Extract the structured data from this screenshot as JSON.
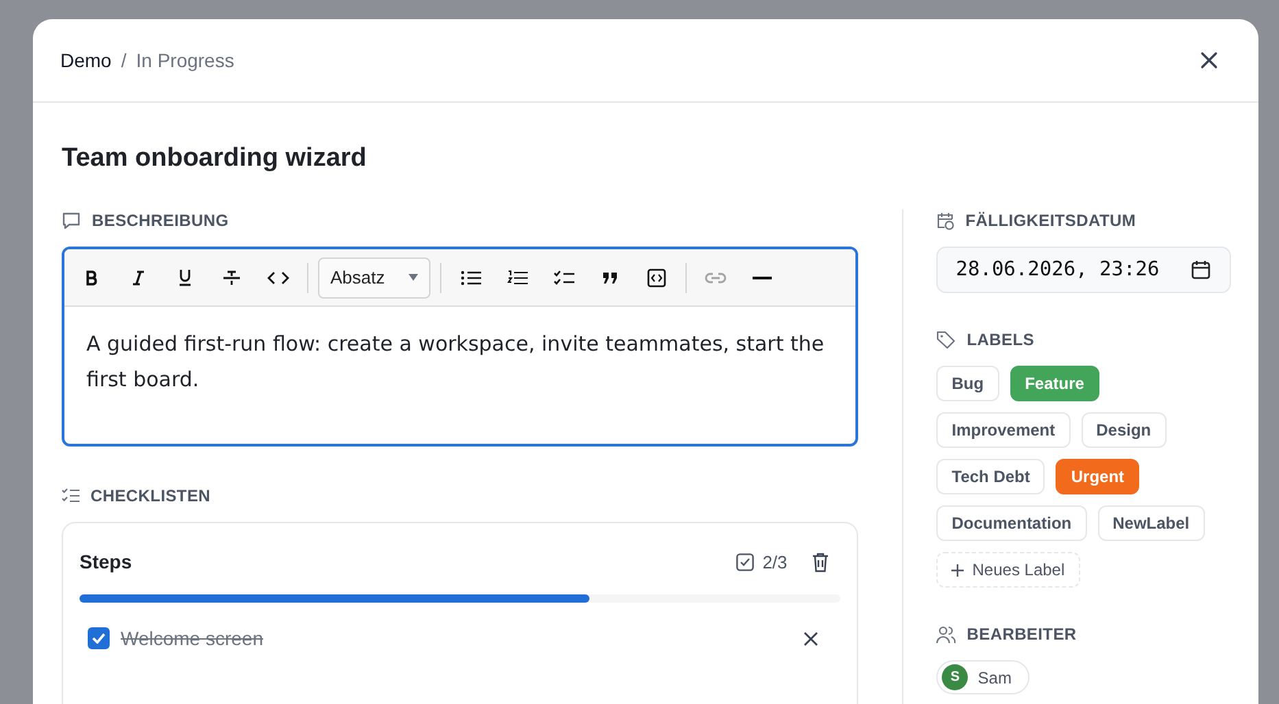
{
  "breadcrumb": {
    "project": "Demo",
    "separator": "/",
    "status": "In Progress"
  },
  "title": "Team onboarding wizard",
  "description": {
    "heading": "BESCHREIBUNG",
    "block_style": "Absatz",
    "text": "A guided first-run flow: create a workspace, invite teammates, start the first board."
  },
  "checklists": {
    "heading": "CHECKLISTEN",
    "lists": [
      {
        "title": "Steps",
        "count": "2/3",
        "level": 0.67,
        "items": [
          {
            "text": "Welcome screen",
            "checked": true
          }
        ]
      }
    ]
  },
  "due_date": {
    "heading": "FÄLLIGKEITSDATUM",
    "value": "28.06.2026, 23:26"
  },
  "labels": {
    "heading": "LABELS",
    "items": [
      {
        "name": "Bug",
        "selected": false
      },
      {
        "name": "Feature",
        "selected": true,
        "color": "#43a55a"
      },
      {
        "name": "Improvement",
        "selected": false
      },
      {
        "name": "Design",
        "selected": false
      },
      {
        "name": "Tech Debt",
        "selected": false
      },
      {
        "name": "Urgent",
        "selected": true,
        "color": "#f26b1d"
      },
      {
        "name": "Documentation",
        "selected": false
      },
      {
        "name": "NewLabel",
        "selected": false
      }
    ],
    "add": "Neues Label"
  },
  "assignees": {
    "heading": "BEARBEITER",
    "people": [
      {
        "initial": "S",
        "name": "Sam",
        "color": "#3a8a45"
      }
    ]
  }
}
